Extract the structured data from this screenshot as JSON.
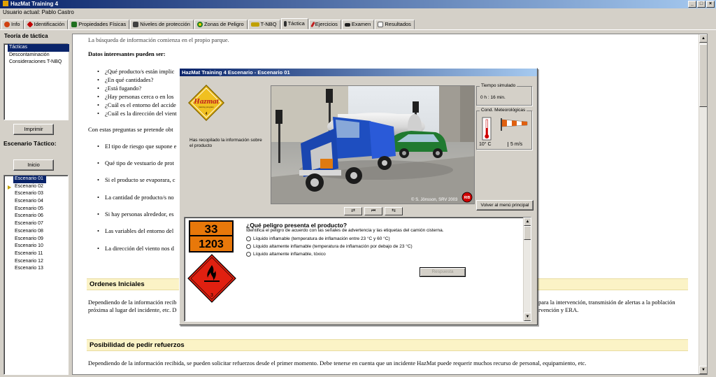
{
  "window": {
    "title": "HazMat Training 4",
    "controls": [
      "_",
      "□",
      "×"
    ]
  },
  "user_line": "Usuario actual: Pablo Castro",
  "tabs": [
    {
      "label": "Info",
      "icon": "info-icon",
      "color": "#d04010"
    },
    {
      "label": "Identificación",
      "icon": "diamond-icon",
      "color": "#c00000"
    },
    {
      "label": "Propiedades Físicas",
      "icon": "molecule-icon",
      "color": "#207020"
    },
    {
      "label": "Niveles de protección",
      "icon": "suit-icon",
      "color": "#404040"
    },
    {
      "label": "Zonas de Peligro",
      "icon": "zone-icon",
      "color": "#208020"
    },
    {
      "label": "T-NBQ",
      "icon": "truck-icon",
      "color": "#c0a000"
    },
    {
      "label": "Táctica",
      "icon": "person-icon",
      "color": "#303030"
    },
    {
      "label": "Ejercicios",
      "icon": "pencil-icon",
      "color": "#c02020"
    },
    {
      "label": "Examen",
      "icon": "cap-icon",
      "color": "#202020"
    },
    {
      "label": "Resultados",
      "icon": "page-icon",
      "color": "#606060"
    }
  ],
  "left_panel": {
    "teoria_title": "Teoría de táctica",
    "teoria_items": [
      "Tácticas",
      "Descontaminación",
      "Consideraciones T-NBQ"
    ],
    "imprimir": "Imprimir",
    "escenario_title": "Escenario Táctico:",
    "inicio": "Inicio",
    "escenarios": [
      "Escenario 01",
      "Escenario 02",
      "Escenario 03",
      "Escenario 04",
      "Escenario 05",
      "Escenario 06",
      "Escenario 07",
      "Escenario 08",
      "Escenario 09",
      "Escenario 10",
      "Escenario 11",
      "Escenario 12",
      "Escenario 13"
    ]
  },
  "doc": {
    "top_cut": "La búsqueda de información comienza en el propio parque.",
    "datos_title": "Datos interesantes pueden ser:",
    "datos_bullets": [
      "¿Qué producto/s están implic",
      "¿En qué cantidades?",
      "¿Está fugando?",
      "¿Hay personas cerca o en los",
      "¿Cuál es el entorno del accide",
      "¿Cuál es la dirección del vient"
    ],
    "con_estas": "Con estas preguntas se pretende obt",
    "bullets2": [
      "El tipo de riesgo que supone e",
      "Qué tipo de vestuario de prot",
      "Si el producto se evaporara, c",
      "La cantidad de producto/s no",
      "Si hay personas alrededor, es",
      "Las variables del entorno del",
      "La dirección del viento nos d"
    ],
    "ordenes_title": "Ordenes Iniciales",
    "ordenes_p1": "Dependiendo de la información recib",
    "ordenes_p1_right": "para la intervención, transmisión de alertas a la población",
    "ordenes_p2": "próxima al lugar del incidente, etc. D",
    "ordenes_p2_right": "rvención y ERA.",
    "refuerzos_title": "Posibilidad de pedir refuerzos",
    "refuerzos_p": "Dependiendo de la información recibida, se pueden solicitar refuerzos desde el primer momento. Debe tenerse en cuenta que un incidente HazMat puede requerir muchos recurso de personal, equipamiento, etc."
  },
  "dialog": {
    "title": "HazMat Training 4 Escenario - Escenario 01",
    "logo": {
      "main": "Hazmat",
      "sub": "training program",
      "num": "4"
    },
    "info": "Has recopilado la información sobre el producto",
    "copyright": "© S. Jönsson, SRV 2003",
    "rib": "RIB",
    "tiempo_label": "Tiempo simulado",
    "tiempo_value": "0 h : 16 min.",
    "meteo_label": "Cond. Meteorológicas",
    "temp": "10° C",
    "wind": "5 m/s",
    "volver": "Volver al menú principal",
    "ctrl": [
      "⇄",
      "⏮",
      "⇆"
    ],
    "plate_top": "33",
    "plate_bottom": "1203",
    "placard_num": "3",
    "question": "¿Qué peligro presenta el producto?",
    "question_sub": "Identifica el peligro de acuerdo con las señales de advertencia y las etiquetas del camión cisterna.",
    "options": [
      "Líquido inflamable (temperatura de inflamación entre 23 °C y 60 °C)",
      "Líquido altamente inflamable (temperatura de inflamación por debajo de 23 °C)",
      "Líquido altamente inflamable, tóxico"
    ],
    "respuesta": "Respuesta"
  }
}
